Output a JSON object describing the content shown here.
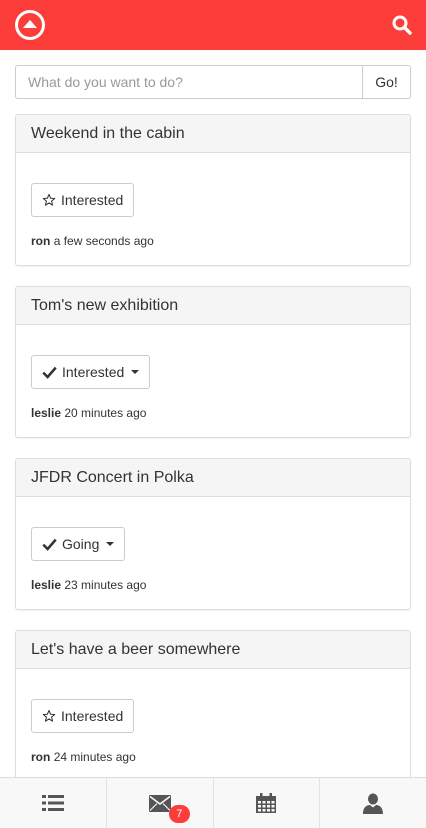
{
  "colors": {
    "brand": "#fc3d39",
    "header_text": "#ffffff"
  },
  "header": {
    "logo_icon": "up-arrow-circle-icon",
    "search_icon": "search-icon"
  },
  "ask": {
    "placeholder": "What do you want to do?",
    "go_label": "Go!"
  },
  "posts": [
    {
      "title": "Weekend in the cabin",
      "rsvp_label": "Interested",
      "rsvp_icon": "star-outline-icon",
      "has_menu": false,
      "author": "ron",
      "time": "a few seconds ago"
    },
    {
      "title": "Tom's new exhibition",
      "rsvp_label": "Interested",
      "rsvp_icon": "check-icon",
      "has_menu": true,
      "author": "leslie",
      "time": "20 minutes ago"
    },
    {
      "title": "JFDR Concert in Polka",
      "rsvp_label": "Going",
      "rsvp_icon": "check-icon",
      "has_menu": true,
      "author": "leslie",
      "time": "23 minutes ago"
    },
    {
      "title": "Let's have a beer somewhere",
      "rsvp_label": "Interested",
      "rsvp_icon": "star-outline-icon",
      "has_menu": false,
      "author": "ron",
      "time": "24 minutes ago"
    }
  ],
  "tabbar": {
    "tabs": [
      {
        "icon": "list-icon"
      },
      {
        "icon": "envelope-icon",
        "badge": "7"
      },
      {
        "icon": "calendar-icon"
      },
      {
        "icon": "user-icon"
      }
    ]
  }
}
